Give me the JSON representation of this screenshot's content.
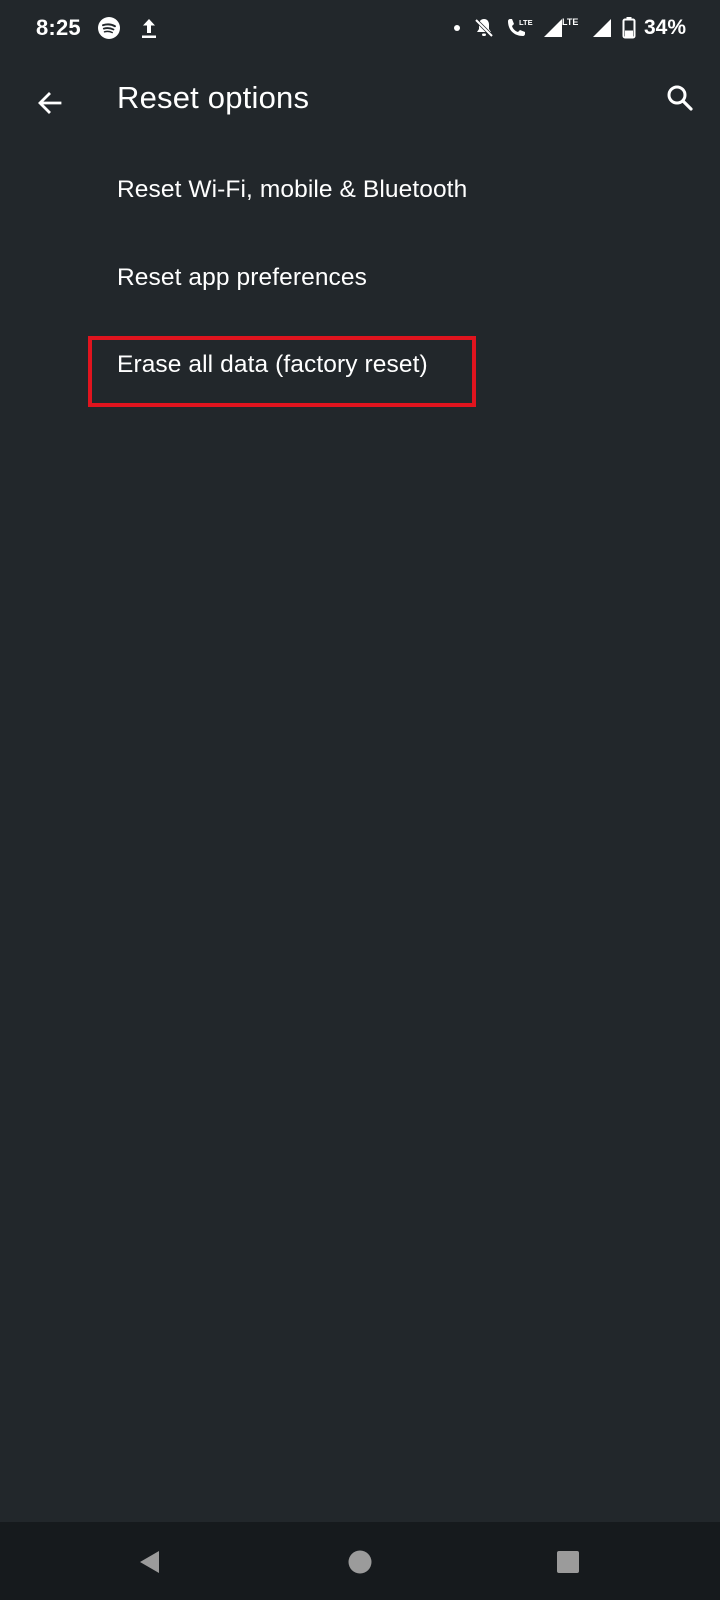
{
  "status_bar": {
    "time": "8:25",
    "left_icons": [
      "spotify-icon",
      "upload-icon"
    ],
    "right_icons": [
      "notification-dot-icon",
      "bell-off-icon",
      "volte-call-icon",
      "signal-lte-icon",
      "signal-icon",
      "battery-icon"
    ],
    "battery_percent": "34%",
    "lte_label": "LTE",
    "volte_label": "LTE"
  },
  "app_bar": {
    "title": "Reset options",
    "back_icon": "arrow-back-icon",
    "search_icon": "search-icon"
  },
  "list": {
    "items": [
      {
        "label": "Reset Wi-Fi, mobile & Bluetooth"
      },
      {
        "label": "Reset app preferences"
      },
      {
        "label": "Erase all data (factory reset)",
        "highlighted": true
      }
    ]
  },
  "highlight_color": "#e0141e",
  "background_color": "#22272b",
  "nav_bar": {
    "buttons": [
      "nav-back-icon",
      "nav-home-icon",
      "nav-recents-icon"
    ]
  }
}
